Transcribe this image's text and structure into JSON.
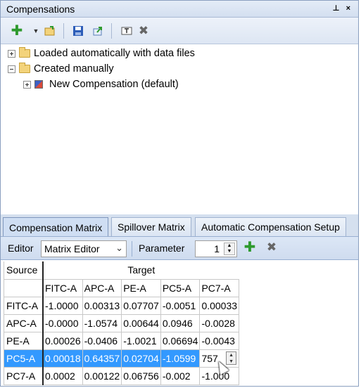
{
  "window": {
    "title": "Compensations",
    "pin_glyph": "⊥",
    "close_glyph": "×"
  },
  "toolbar": {
    "add_icon": "plus-icon",
    "dropdown_icon": "chevron-down-icon",
    "import_icon": "import-folder-icon",
    "save_icon": "save-icon",
    "export_icon": "export-icon",
    "rename_icon": "text-field-icon",
    "delete_icon": "delete-icon"
  },
  "tree": {
    "items": [
      {
        "label": "Loaded automatically with data files",
        "expanded": false
      },
      {
        "label": "Created manually",
        "expanded": true
      },
      {
        "label": "New Compensation  (default)",
        "child": true
      }
    ]
  },
  "tabs": [
    {
      "label": "Compensation Matrix",
      "active": true
    },
    {
      "label": "Spillover Matrix",
      "active": false
    },
    {
      "label": "Automatic Compensation Setup",
      "active": false
    }
  ],
  "editor": {
    "editor_label": "Editor",
    "editor_value": "Matrix Editor",
    "parameter_label": "Parameter",
    "parameter_value": "1"
  },
  "matrix": {
    "source_header": "Source",
    "target_header": "Target",
    "columns": [
      "FITC-A",
      "APC-A",
      "PE-A",
      "PC5-A",
      "PC7-A"
    ],
    "rows": [
      {
        "name": "FITC-A",
        "values": [
          "-1.0000",
          "0.00313",
          "0.07707",
          "-0.0051",
          "0.00033"
        ]
      },
      {
        "name": "APC-A",
        "values": [
          "-0.0000",
          "-1.0574",
          "0.00644",
          "0.0946",
          "-0.0028"
        ]
      },
      {
        "name": "PE-A",
        "values": [
          "0.00026",
          "-0.0406",
          "-1.0021",
          "0.06694",
          "-0.0043"
        ]
      },
      {
        "name": "PC5-A",
        "values": [
          "0.00018",
          "0.64357",
          "0.02704",
          "-1.0599",
          "757"
        ],
        "selected": true
      },
      {
        "name": "PC7-A",
        "values": [
          "0.0002",
          "0.00122",
          "0.06756",
          "-0.002",
          "-1.000"
        ]
      }
    ]
  }
}
